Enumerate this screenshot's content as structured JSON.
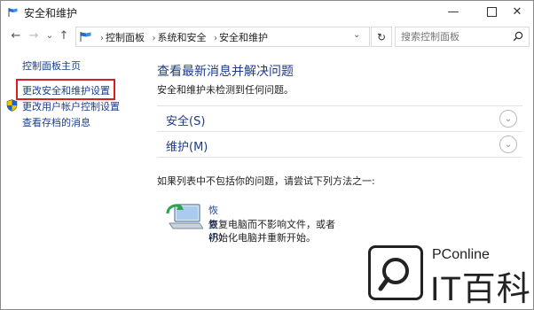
{
  "window": {
    "title": "安全和维护",
    "minimize_glyph": "—",
    "close_glyph": "✕"
  },
  "nav": {
    "back_glyph": "←",
    "forward_glyph": "→",
    "recent_glyph": "⌄",
    "up_glyph": "↑",
    "breadcrumbs": [
      "控制面板",
      "系统和安全",
      "安全和维护"
    ],
    "crumb_separator": "›",
    "address_dropdown_glyph": "⌄",
    "refresh_glyph": "↻",
    "search_placeholder": "搜索控制面板"
  },
  "sidebar": {
    "items": [
      {
        "label": "控制面板主页"
      },
      {
        "label": "更改安全和维护设置"
      },
      {
        "label": "更改用户帐户控制设置"
      },
      {
        "label": "查看存档的消息"
      }
    ]
  },
  "main": {
    "heading": "查看最新消息并解决问题",
    "subtext": "安全和维护未检测到任何问题。",
    "sections": [
      {
        "label": "安全(S)",
        "chevron": "⌄"
      },
      {
        "label": "维护(M)",
        "chevron": "⌄"
      }
    ],
    "hint": "如果列表中不包括你的问题，请尝试下列方法之一:",
    "recovery": {
      "link": "恢复(R)",
      "desc_line1": "恢复电脑而不影响文件，或者",
      "desc_line2": "初始化电脑并重新开始。"
    }
  },
  "watermark": {
    "brand": "PConline",
    "logo_text": "IT百科"
  },
  "colors": {
    "link": "#1a3f8c",
    "heading": "#1e3a8a",
    "highlight_box": "#d42020"
  }
}
